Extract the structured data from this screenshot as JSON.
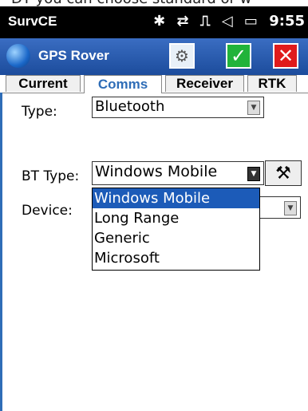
{
  "top_caption": "DT you can choose standard or w",
  "statusbar": {
    "app_name": "SurvCE",
    "bluetooth_icon": "✱",
    "sync_icon": "⇄",
    "signal_icon": "⎍",
    "volume_icon": "◁",
    "battery_icon": "▭",
    "time": "9:55"
  },
  "titlebar": {
    "title": "GPS Rover",
    "config_icon": "⚙",
    "ok_icon": "✓",
    "close_icon": "✕"
  },
  "tabs": [
    "Current",
    "Comms",
    "Receiver",
    "RTK"
  ],
  "form": {
    "type_label": "Type:",
    "type_value": "Bluetooth",
    "bt_type_label": "BT Type:",
    "bt_type_value": "Windows Mobile",
    "device_label": "Device:",
    "wrench_icon": "⚒"
  },
  "dropdown_options": [
    "Windows Mobile",
    "Long Range",
    "Generic",
    "Microsoft"
  ]
}
